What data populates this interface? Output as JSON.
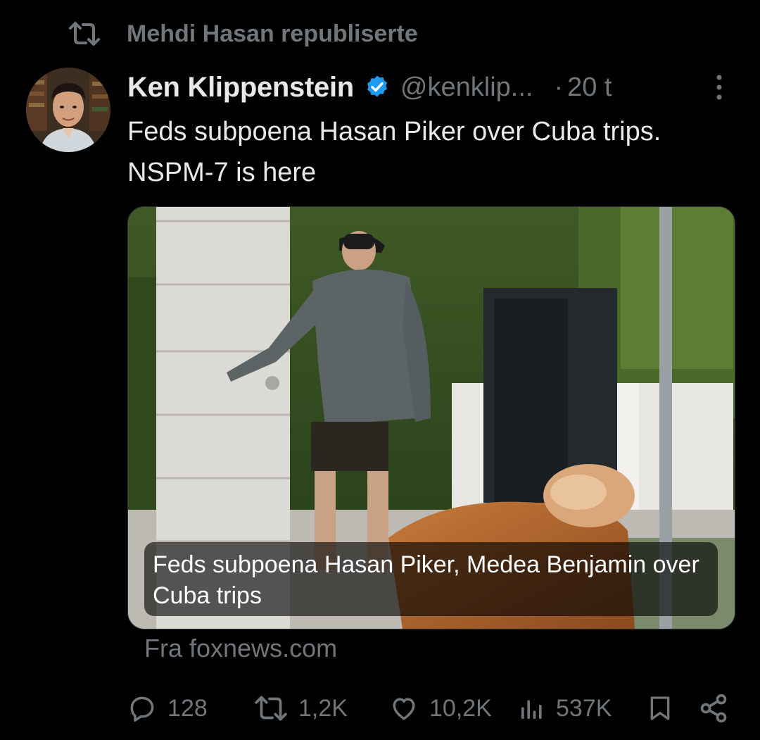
{
  "repost": {
    "text": "Mehdi Hasan republiserte"
  },
  "tweet": {
    "author_name": "Ken Klippenstein",
    "handle": "@kenklip...",
    "separator": "·",
    "time": "20 t",
    "text": "Feds subpoena Hasan Piker over Cuba trips. NSPM-7 is here",
    "verified": true
  },
  "card": {
    "caption": "Feds subpoena Hasan Piker, Medea Benjamin over Cuba trips",
    "source": "Fra foxnews.com"
  },
  "actions": {
    "replies": "128",
    "reposts": "1,2K",
    "likes": "10,2K",
    "views": "537K"
  },
  "colors": {
    "background": "#000000",
    "text": "#e7e9ea",
    "muted": "#71767b",
    "verified": "#1d9bf0"
  },
  "icons": [
    "repost-icon",
    "verified-badge-icon",
    "more-icon",
    "reply-icon",
    "like-icon",
    "views-icon",
    "bookmark-icon",
    "share-icon"
  ]
}
